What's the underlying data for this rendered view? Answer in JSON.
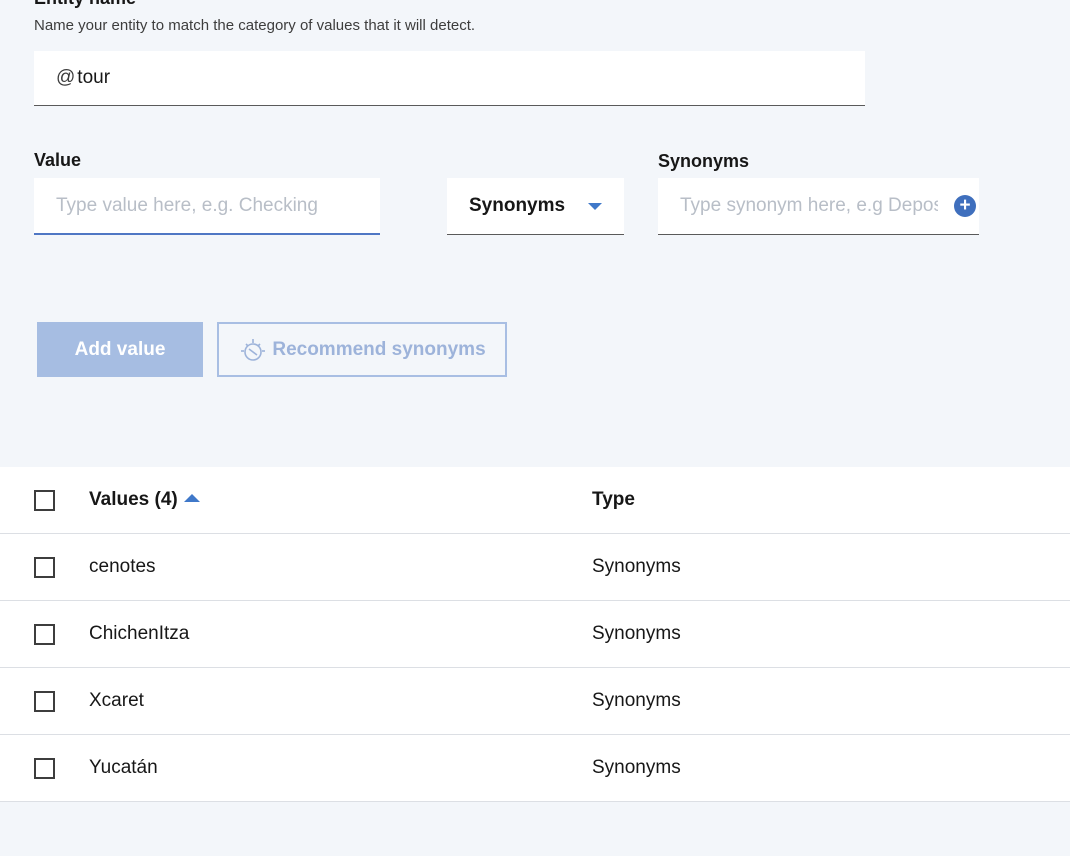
{
  "entity": {
    "label": "Entity name",
    "help": "Name your entity to match the category of values that it will detect.",
    "prefix": "@",
    "value": "tour"
  },
  "value_field": {
    "label": "Value",
    "placeholder": "Type value here, e.g. Checking"
  },
  "type_select": {
    "selected": "Synonyms"
  },
  "synonyms_field": {
    "label": "Synonyms",
    "placeholder": "Type synonym here, e.g Deposit"
  },
  "buttons": {
    "add_value": "Add value",
    "recommend": "Recommend synonyms"
  },
  "table": {
    "col_values": "Values (4)",
    "col_type": "Type",
    "rows": [
      {
        "value": "cenotes",
        "type": "Synonyms"
      },
      {
        "value": "ChichenItza",
        "type": "Synonyms"
      },
      {
        "value": "Xcaret",
        "type": "Synonyms"
      },
      {
        "value": "Yucatán",
        "type": "Synonyms"
      }
    ]
  },
  "colors": {
    "accent": "#3f78c9",
    "disabled_button": "#a6bde2",
    "background": "#f3f6fa"
  }
}
